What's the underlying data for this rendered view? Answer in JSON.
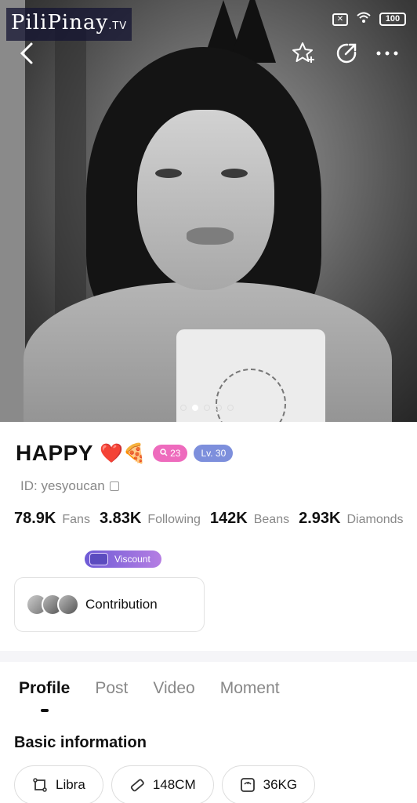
{
  "watermark": {
    "brand": "PiliPinay",
    "suffix": ".TV"
  },
  "status_bar": {
    "sim": "✕",
    "wifi": "wifi",
    "battery": "100"
  },
  "nav": {
    "back": "‹",
    "star": "☆",
    "share": "↗",
    "more": "•••"
  },
  "carousel": {
    "count": 5,
    "active_index": 1
  },
  "profile": {
    "name": "HAPPY",
    "emojis": "❤️🍕",
    "search_badge": "23",
    "level_badge": "Lv. 30",
    "id_text": "ID: yesyoucan",
    "stats": [
      {
        "value": "78.9K",
        "label": "Fans"
      },
      {
        "value": "3.83K",
        "label": "Following"
      },
      {
        "value": "142K",
        "label": "Beans"
      },
      {
        "value": "2.93K",
        "label": "Diamonds"
      }
    ],
    "rank_badge": "Viscount",
    "contribution_label": "Contribution"
  },
  "tabs": [
    {
      "label": "Profile",
      "active": true
    },
    {
      "label": "Post",
      "active": false
    },
    {
      "label": "Video",
      "active": false
    },
    {
      "label": "Moment",
      "active": false
    }
  ],
  "basic_info": {
    "title": "Basic information",
    "chips": [
      {
        "icon": "zodiac-icon",
        "label": "Libra"
      },
      {
        "icon": "ruler-icon",
        "label": "148CM"
      },
      {
        "icon": "scale-icon",
        "label": "36KG"
      }
    ]
  }
}
